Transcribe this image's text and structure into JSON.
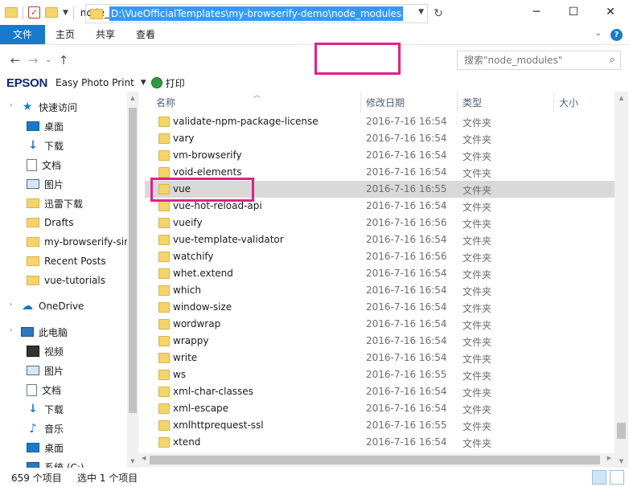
{
  "window": {
    "title": "node_modules"
  },
  "window_controls": {
    "minimize": "─",
    "maximize": "☐",
    "close": "✕"
  },
  "ribbon": {
    "tabs": [
      "文件",
      "主页",
      "共享",
      "查看"
    ],
    "expand_glyph": "⌄",
    "help_glyph": "?"
  },
  "nav_buttons": {
    "back": "←",
    "forward": "→",
    "recent": "⌄",
    "up": "↑",
    "refresh": "↻"
  },
  "address": {
    "path": "D:\\VueOfficialTemplates\\my-browserify-demo\\node_modules"
  },
  "search": {
    "placeholder": "搜索\"node_modules\"",
    "icon_glyph": "⌕"
  },
  "epson_bar": {
    "brand": "EPSON",
    "app": "Easy Photo Print",
    "print_label": "打印"
  },
  "sidebar": {
    "quick_access": "快速访问",
    "items": [
      {
        "label": "桌面",
        "icon": "desktop-icon",
        "pinned": true
      },
      {
        "label": "下载",
        "icon": "download-icon",
        "pinned": true
      },
      {
        "label": "文档",
        "icon": "document-icon",
        "pinned": true
      },
      {
        "label": "图片",
        "icon": "pictures-icon",
        "pinned": true
      },
      {
        "label": "迅雷下载",
        "icon": "folder-icon",
        "pinned": true
      },
      {
        "label": "Drafts",
        "icon": "folder-icon",
        "pinned": false
      },
      {
        "label": "my-browserify-sir",
        "icon": "folder-icon",
        "pinned": false
      },
      {
        "label": "Recent Posts",
        "icon": "folder-icon",
        "pinned": false
      },
      {
        "label": "vue-tutorials",
        "icon": "folder-icon",
        "pinned": false
      }
    ],
    "onedrive": "OneDrive",
    "this_pc": "此电脑",
    "pc_items": [
      {
        "label": "视频",
        "icon": "video-icon"
      },
      {
        "label": "图片",
        "icon": "pictures-icon"
      },
      {
        "label": "文档",
        "icon": "document-icon"
      },
      {
        "label": "下载",
        "icon": "download-icon"
      },
      {
        "label": "音乐",
        "icon": "music-icon"
      },
      {
        "label": "桌面",
        "icon": "desktop-icon"
      },
      {
        "label": "系统 (C:)",
        "icon": "drive-icon"
      }
    ]
  },
  "columns": {
    "name": "名称",
    "date": "修改日期",
    "type": "类型",
    "size": "大小"
  },
  "files": [
    {
      "name": "validate-npm-package-license",
      "date": "2016-7-16 16:54",
      "type": "文件夹"
    },
    {
      "name": "vary",
      "date": "2016-7-16 16:54",
      "type": "文件夹"
    },
    {
      "name": "vm-browserify",
      "date": "2016-7-16 16:54",
      "type": "文件夹"
    },
    {
      "name": "void-elements",
      "date": "2016-7-16 16:54",
      "type": "文件夹"
    },
    {
      "name": "vue",
      "date": "2016-7-16 16:55",
      "type": "文件夹",
      "selected": true
    },
    {
      "name": "vue-hot-reload-api",
      "date": "2016-7-16 16:54",
      "type": "文件夹"
    },
    {
      "name": "vueify",
      "date": "2016-7-16 16:56",
      "type": "文件夹"
    },
    {
      "name": "vue-template-validator",
      "date": "2016-7-16 16:54",
      "type": "文件夹"
    },
    {
      "name": "watchify",
      "date": "2016-7-16 16:56",
      "type": "文件夹"
    },
    {
      "name": "whet.extend",
      "date": "2016-7-16 16:54",
      "type": "文件夹"
    },
    {
      "name": "which",
      "date": "2016-7-16 16:54",
      "type": "文件夹"
    },
    {
      "name": "window-size",
      "date": "2016-7-16 16:54",
      "type": "文件夹"
    },
    {
      "name": "wordwrap",
      "date": "2016-7-16 16:54",
      "type": "文件夹"
    },
    {
      "name": "wrappy",
      "date": "2016-7-16 16:54",
      "type": "文件夹"
    },
    {
      "name": "write",
      "date": "2016-7-16 16:54",
      "type": "文件夹"
    },
    {
      "name": "ws",
      "date": "2016-7-16 16:55",
      "type": "文件夹"
    },
    {
      "name": "xml-char-classes",
      "date": "2016-7-16 16:54",
      "type": "文件夹"
    },
    {
      "name": "xml-escape",
      "date": "2016-7-16 16:54",
      "type": "文件夹"
    },
    {
      "name": "xmlhttprequest-ssl",
      "date": "2016-7-16 16:55",
      "type": "文件夹"
    },
    {
      "name": "xtend",
      "date": "2016-7-16 16:54",
      "type": "文件夹"
    }
  ],
  "status": {
    "count": "659 个项目",
    "selected": "选中 1 个项目"
  },
  "colors": {
    "accent": "#1979ca",
    "highlight": "#e0218a",
    "selection": "#d9d9d9",
    "address_selection": "#3399ff"
  }
}
